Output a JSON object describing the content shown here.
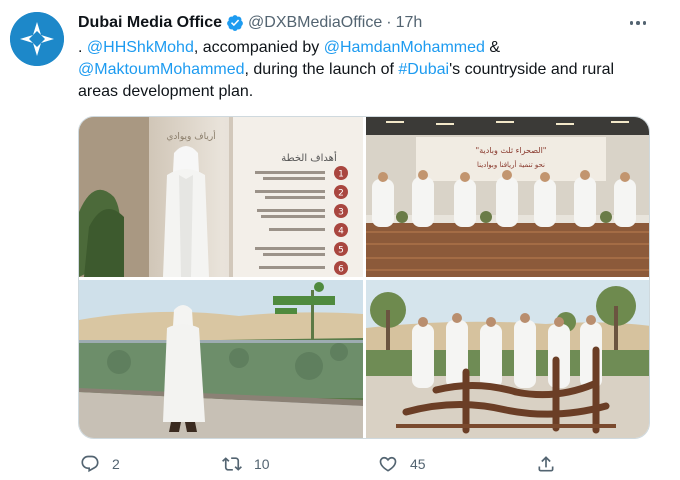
{
  "tweet": {
    "author": {
      "name": "Dubai Media Office",
      "handle": "@DXBMediaOffice",
      "separator": "·",
      "time": "17h",
      "verified": true,
      "avatar_icon": "dubai-media-office-logo-icon"
    },
    "more_icon": "more-icon",
    "text": {
      "prefix": ". ",
      "mention1": "@HHShkMohd",
      "part2": ", accompanied by ",
      "mention2": "@HamdanMohammed",
      "part3": " & ",
      "mention3": "@MaktoumMohammed",
      "part4": ", during the launch of ",
      "hashtag": "#Dubai",
      "part5": "'s countryside and rural areas development plan."
    },
    "photos": [
      {
        "name": "photo-plan-goals-board",
        "heading": "أهداف الخطة",
        "side_text": "أرياف ويوادي",
        "numbers": [
          "1",
          "2",
          "3",
          "4",
          "5",
          "6"
        ]
      },
      {
        "name": "photo-group-seated-majlis",
        "banner_line1": "\"الصحراء ثلث وبادية\"",
        "banner_line2": "نحو تنمية أريافنا وبوادينا"
      },
      {
        "name": "photo-walking-desert-terrace"
      },
      {
        "name": "photo-group-standing-sculpture"
      }
    ],
    "actions": {
      "reply": {
        "icon": "reply-icon",
        "count": "2"
      },
      "retweet": {
        "icon": "retweet-icon",
        "count": "10"
      },
      "like": {
        "icon": "heart-icon",
        "count": "45"
      },
      "share": {
        "icon": "share-icon",
        "count": ""
      }
    },
    "colors": {
      "link": "#1d9bf0",
      "verified": "#1d9bf0",
      "muted": "#536471",
      "avatar": "#1d88c9"
    }
  }
}
